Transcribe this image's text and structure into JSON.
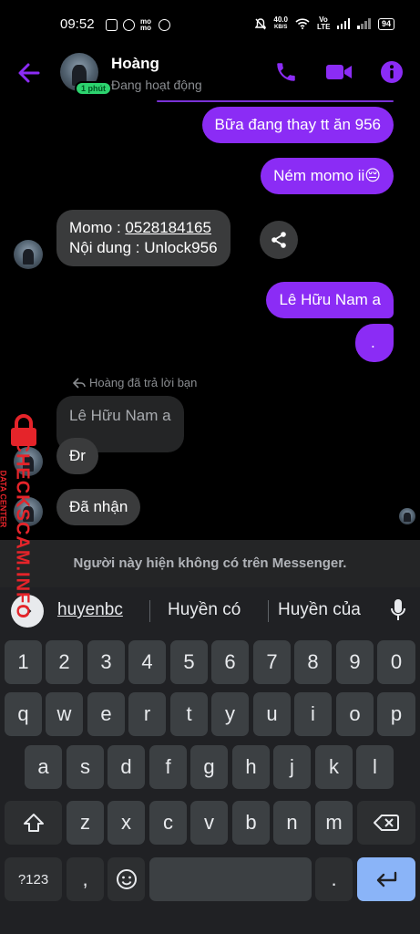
{
  "status_bar": {
    "time": "09:52",
    "momo": "mo mo",
    "speed_value": "40.0",
    "speed_unit": "KB/S",
    "volte": "Vo LTE",
    "battery": "94"
  },
  "header": {
    "contact_name": "Hoàng",
    "active_badge": "1 phút",
    "status_text": "Đang hoạt động",
    "icons": [
      "back-arrow-icon",
      "phone-icon",
      "video-icon",
      "info-icon"
    ],
    "accent_color": "#8b2cf5"
  },
  "messages": {
    "m1": "Bữa đang thay tt ăn 956",
    "m2": "Ném momo ii😔",
    "m3_line1_prefix": "Momo : ",
    "m3_phone": "0528184165",
    "m3_line2": "Nội dung : Unlock956",
    "m4": "Lê Hữu Nam a",
    "m5": ".",
    "reply_label": "Hoàng đã trả lời bạn",
    "quoted": "Lê Hữu Nam a",
    "m6": "Đr",
    "m7": "Đã nhận"
  },
  "notice": "Người này hiện không có trên Messenger.",
  "suggestions": [
    "huyenbc",
    "Huyền có",
    "Huyền của"
  ],
  "keyboard": {
    "row1": [
      "1",
      "2",
      "3",
      "4",
      "5",
      "6",
      "7",
      "8",
      "9",
      "0"
    ],
    "row2": [
      "q",
      "w",
      "e",
      "r",
      "t",
      "y",
      "u",
      "i",
      "o",
      "p"
    ],
    "row3": [
      "a",
      "s",
      "d",
      "f",
      "g",
      "h",
      "j",
      "k",
      "l"
    ],
    "row4": [
      "z",
      "x",
      "c",
      "v",
      "b",
      "n",
      "m"
    ],
    "symbols_key": "?123",
    "comma_key": ",",
    "period_key": "."
  },
  "watermark": {
    "text": "CHECKSCAM.INFO",
    "sub": "DATA CENTER"
  }
}
